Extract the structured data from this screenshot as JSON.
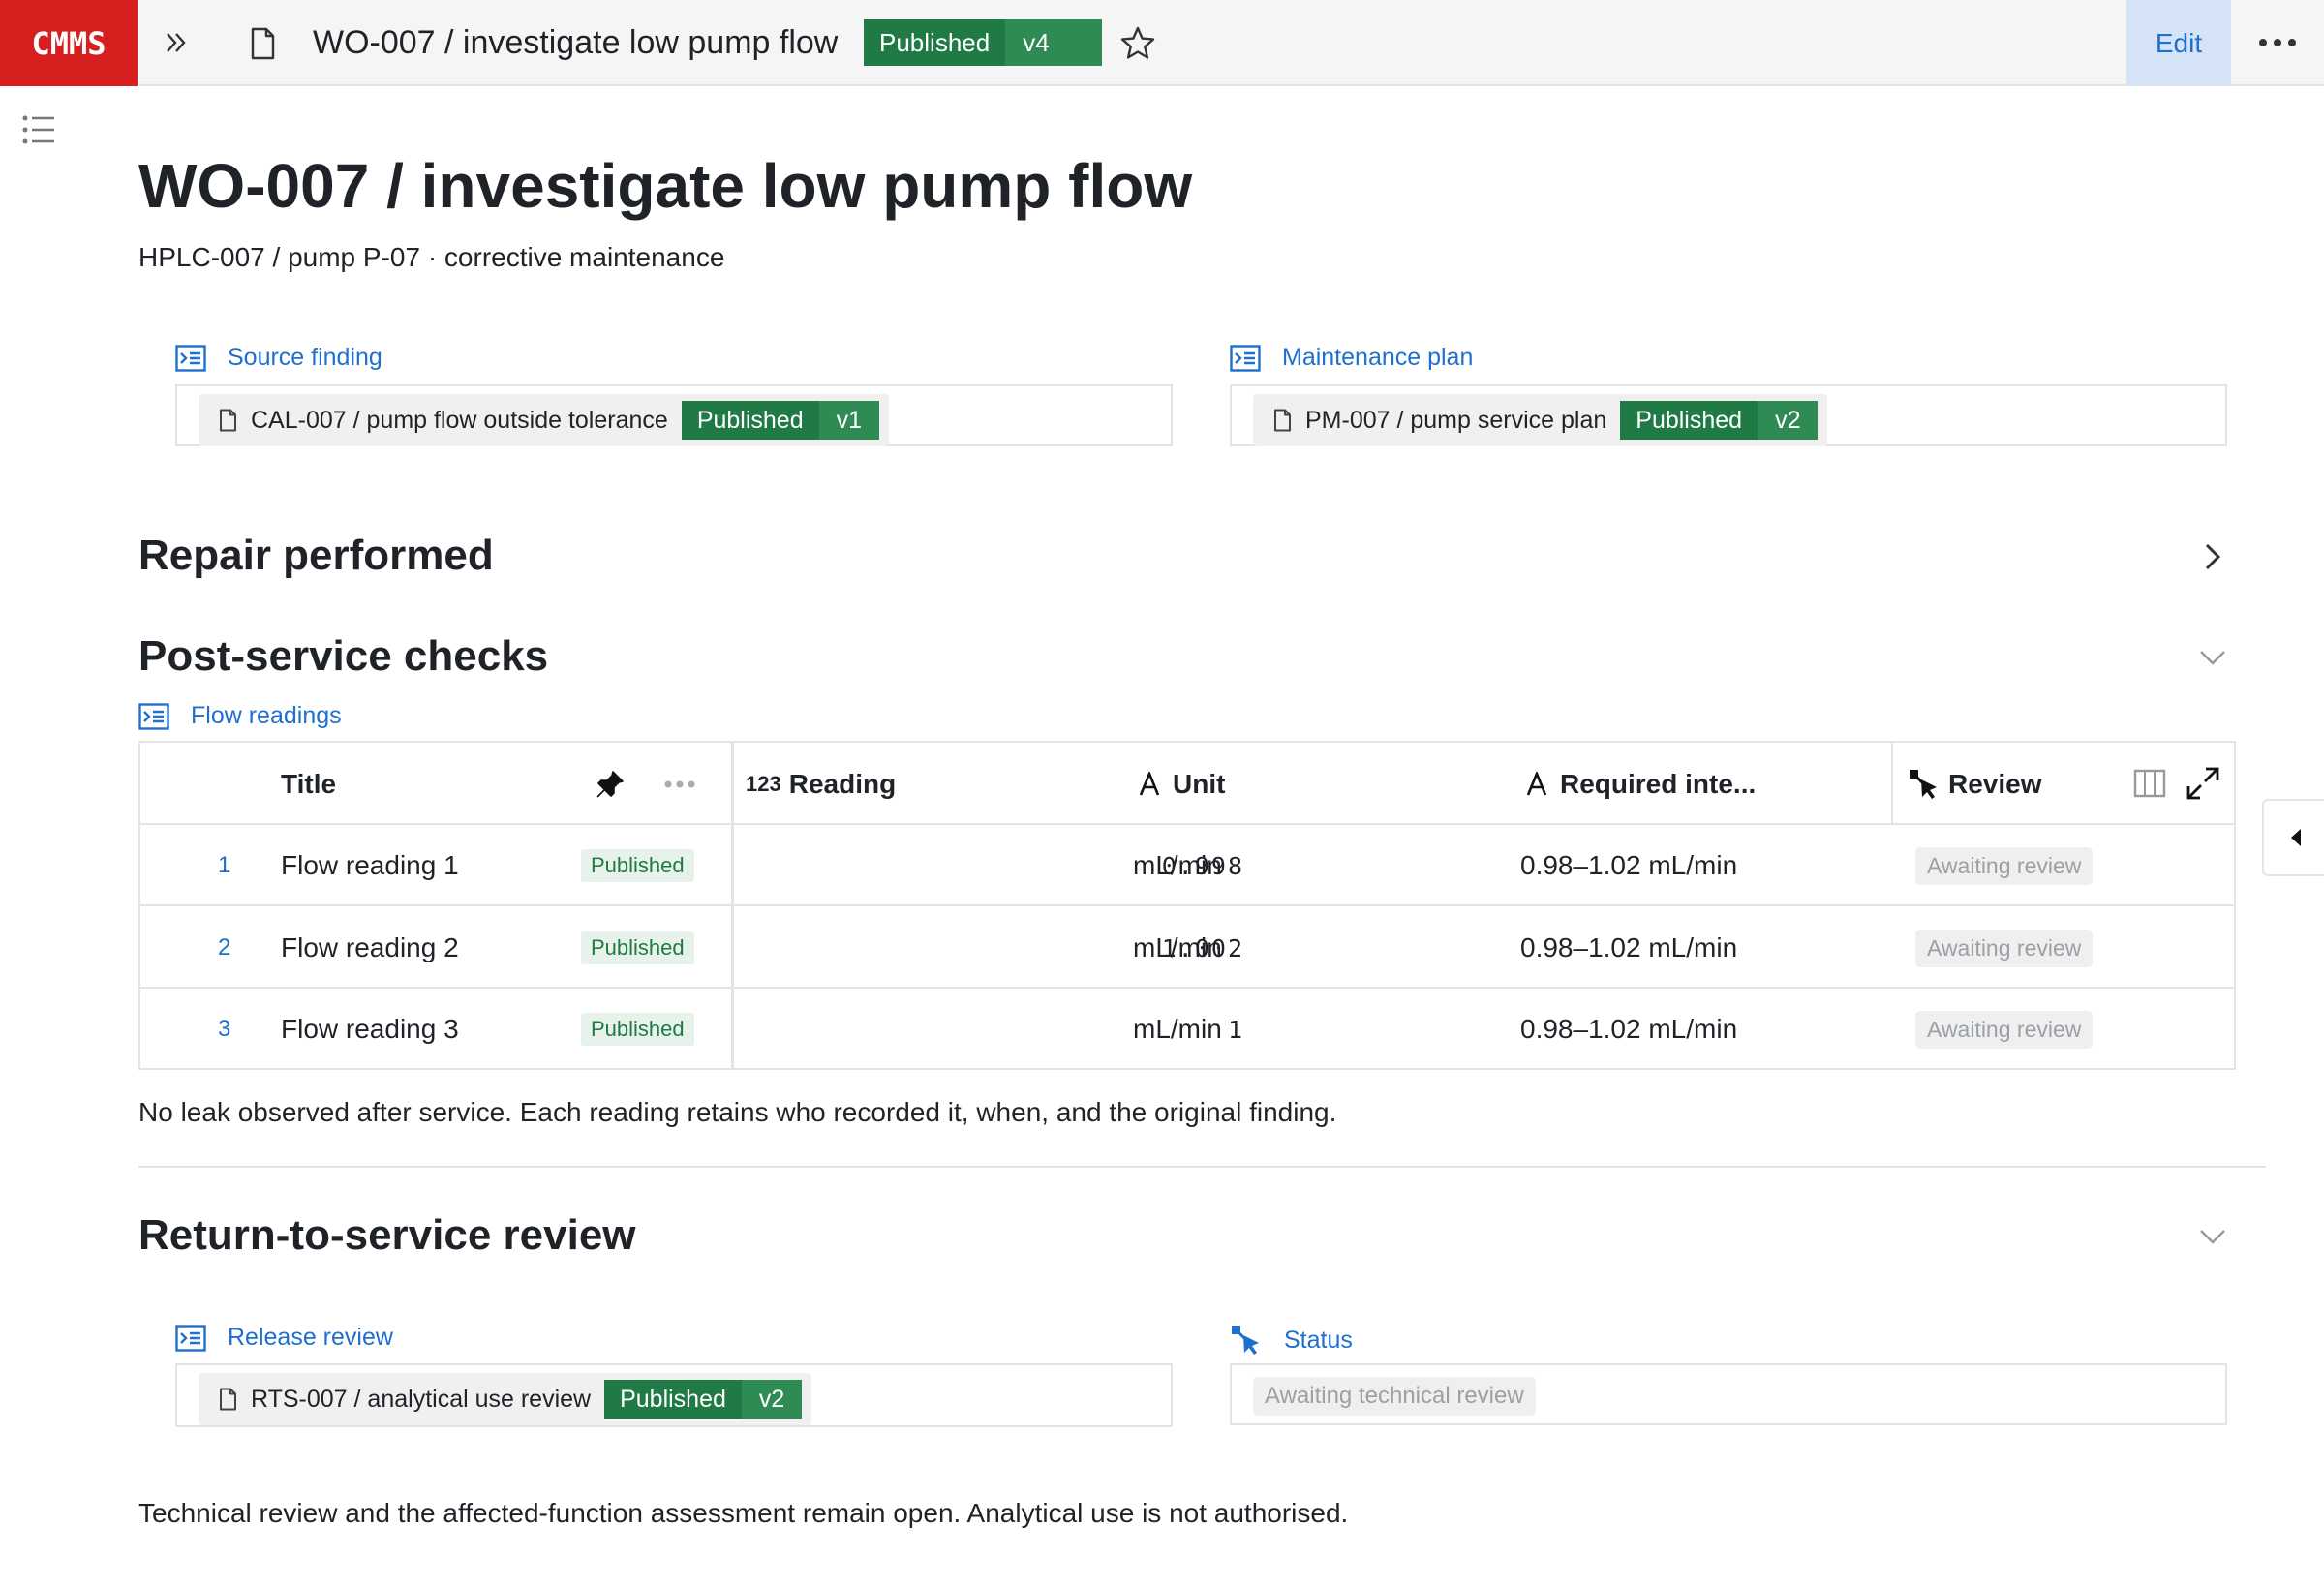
{
  "topbar": {
    "logo": "CMMS",
    "title": "WO-007 / investigate low pump flow",
    "status": "Published",
    "version": "v4",
    "edit_label": "Edit"
  },
  "page": {
    "title": "WO-007 / investigate low pump flow",
    "subtitle": "HPLC-007 / pump P-07 · corrective maintenance"
  },
  "source_finding": {
    "label": "Source finding",
    "ref": "CAL-007 / pump flow outside tolerance",
    "status": "Published",
    "version": "v1"
  },
  "maintenance_plan": {
    "label": "Maintenance plan",
    "ref": "PM-007 / pump service plan",
    "status": "Published",
    "version": "v2"
  },
  "sections": {
    "repair": "Repair performed",
    "checks": "Post-service checks",
    "rts": "Return-to-service review"
  },
  "flow_readings": {
    "label": "Flow readings",
    "columns": {
      "title": "Title",
      "reading_type": "123",
      "reading": "Reading",
      "unit": "Unit",
      "required": "Required inte...",
      "review": "Review"
    },
    "rows": [
      {
        "num": "1",
        "title": "Flow reading 1",
        "status": "Published",
        "reading": "0.998",
        "unit": "mL/min",
        "required": "0.98–1.02 mL/min",
        "review": "Awaiting review"
      },
      {
        "num": "2",
        "title": "Flow reading 2",
        "status": "Published",
        "reading": "1.002",
        "unit": "mL/min",
        "required": "0.98–1.02 mL/min",
        "review": "Awaiting review"
      },
      {
        "num": "3",
        "title": "Flow reading 3",
        "status": "Published",
        "reading": "1",
        "unit": "mL/min",
        "required": "0.98–1.02 mL/min",
        "review": "Awaiting review"
      }
    ],
    "note": "No leak observed after service. Each reading retains who recorded it, when, and the original finding."
  },
  "release_review": {
    "label": "Release review",
    "ref": "RTS-007 / analytical use review",
    "status": "Published",
    "version": "v2"
  },
  "status_field": {
    "label": "Status",
    "value": "Awaiting technical review"
  },
  "footer_note": "Technical review and the affected-function assessment remain open. Analytical use is not authorised.",
  "colors": {
    "brand": "#d81f1f",
    "published": "#1f7a45",
    "link": "#1f6fcf",
    "edit_bg": "#d5e3f6"
  },
  "icons": [
    "double-chevron-right-icon",
    "document-icon",
    "star-icon",
    "more-icon",
    "list-icon",
    "relation-icon",
    "pin-icon",
    "number-icon",
    "text-icon",
    "select-icon",
    "columns-icon",
    "expand-icon",
    "chevron-right-icon",
    "chevron-down-icon",
    "caret-left-icon"
  ]
}
